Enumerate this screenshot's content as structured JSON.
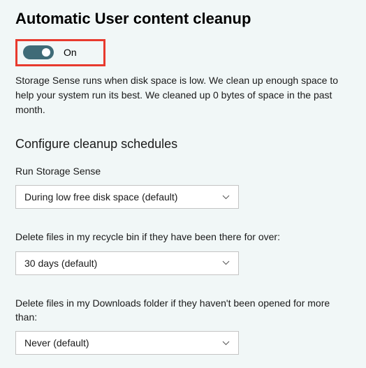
{
  "page": {
    "title": "Automatic User content cleanup"
  },
  "toggle": {
    "state_label": "On"
  },
  "description": "Storage Sense runs when disk space is low. We clean up enough space to help your system run its best. We cleaned up 0 bytes of space in the past month.",
  "section": {
    "title": "Configure cleanup schedules"
  },
  "fields": {
    "run_sense": {
      "label": "Run Storage Sense",
      "value": "During low free disk space (default)"
    },
    "recycle_bin": {
      "label": "Delete files in my recycle bin if they have been there for over:",
      "value": "30 days (default)"
    },
    "downloads": {
      "label": "Delete files in my Downloads folder if they haven't been opened for more than:",
      "value": "Never (default)"
    }
  }
}
